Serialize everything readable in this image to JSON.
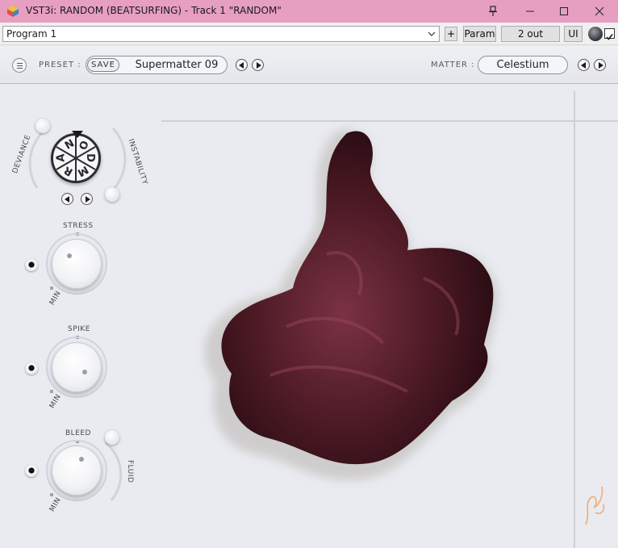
{
  "window": {
    "title": "VST3i: RANDOM (BEATSURFING) - Track 1 \"RANDOM\""
  },
  "host_toolbar": {
    "program": "Program 1",
    "plus_label": "+",
    "param_label": "Param",
    "out_label": "2 out",
    "ui_label": "UI"
  },
  "plugin_header": {
    "preset_label": "PRESET :",
    "save_label": "SAVE",
    "preset_name": "Supermatter 09",
    "matter_label": "MATTER :",
    "matter_name": "Celestium"
  },
  "controls": {
    "deviance_label": "DEVIANCE",
    "instability_label": "INSTABILITY",
    "wheel_letters": [
      "R",
      "A",
      "N",
      "D",
      "O",
      "M"
    ],
    "stress_label": "STRESS",
    "spike_label": "SPIKE",
    "bleed_label": "BLEED",
    "fluid_label": "FLUID",
    "min_label": "MIN"
  },
  "colors": {
    "titlebar": "#e69fc1",
    "matter_blob": "#5a1f2a",
    "panel_bg": "#e9ebf1"
  },
  "icons": {
    "app": "cube-logo-icon",
    "pin": "pin-icon",
    "minimize": "minimize-icon",
    "maximize": "maximize-icon",
    "close": "close-icon",
    "menu": "hamburger-menu-icon"
  }
}
